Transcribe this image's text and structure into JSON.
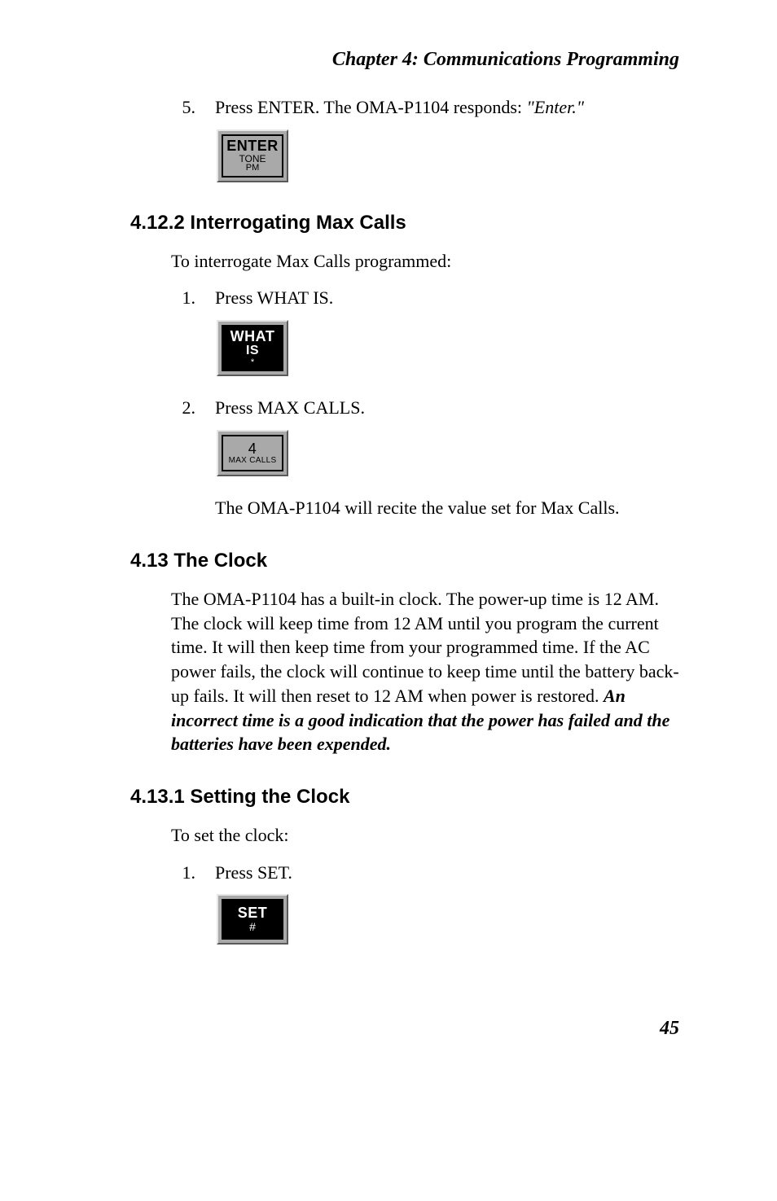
{
  "chapter_header": "Chapter 4: Communications Programming",
  "step5": {
    "num": "5.",
    "text_before": "Press ENTER. The OMA-P1104 responds: ",
    "text_italic": "\"Enter.\""
  },
  "key_enter": {
    "line1": "ENTER",
    "line2": "TONE",
    "line3": "PM"
  },
  "section_4_12_2": "4.12.2  Interrogating Max Calls",
  "para_4_12_2_intro": "To interrogate Max Calls programmed:",
  "step_4_12_2_1": {
    "num": "1.",
    "text": "Press WHAT IS."
  },
  "key_whatis": {
    "line1": "WHAT",
    "line2": "IS",
    "line3": "*"
  },
  "step_4_12_2_2": {
    "num": "2.",
    "text": "Press MAX CALLS."
  },
  "key_maxcalls": {
    "line1": "4",
    "line2": "MAX CALLS"
  },
  "step_4_12_2_2_after": "The OMA-P1104 will recite the value set for Max Calls.",
  "section_4_13": "4.13  The Clock",
  "para_4_13_body_plain": "The OMA-P1104 has a built-in clock. The power-up time is 12 AM. The clock will keep time from 12 AM until you program the current time. It will then keep time from your programmed time. If the AC power fails, the clock will continue to keep time until the battery back-up fails. It will then reset to 12 AM when power is restored. ",
  "para_4_13_body_emph": "An incorrect time is a good indication that the power has failed and the batteries have been expended.",
  "section_4_13_1": "4.13.1  Setting the Clock",
  "para_4_13_1_intro": "To set the clock:",
  "step_4_13_1_1": {
    "num": "1.",
    "text": "Press SET."
  },
  "key_set": {
    "line1": "SET",
    "line2": "#"
  },
  "page_number": "45"
}
